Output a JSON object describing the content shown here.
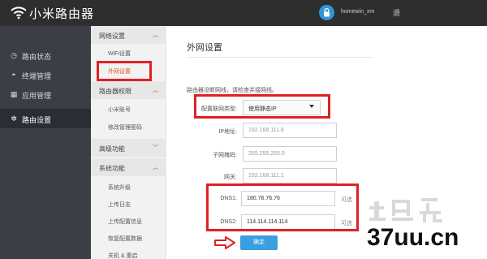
{
  "header": {
    "brand": "小米路由器",
    "user_name": "homewin_xm",
    "user_extra": "退"
  },
  "sidebar": {
    "items": [
      {
        "label": "路由状态",
        "icon": "gauge-icon"
      },
      {
        "label": "终端管理",
        "icon": "user-icon"
      },
      {
        "label": "应用管理",
        "icon": "grid-icon"
      },
      {
        "label": "路由设置",
        "icon": "gear-icon",
        "active": true
      }
    ]
  },
  "submenu": {
    "groups": [
      {
        "label": "网络设置",
        "chevron": "︿",
        "items": [
          "WiFi设置",
          "外网设置"
        ]
      },
      {
        "label": "路由器权限",
        "chevron": "︿",
        "items": [
          "小米账号",
          "修改管理密码"
        ]
      },
      {
        "label": "高级功能",
        "chevron": "﹀",
        "items": []
      },
      {
        "label": "系统功能",
        "chevron": "︿",
        "items": [
          "系统升级",
          "上传日志",
          "上传配置信息",
          "恢复配置数据",
          "关机 & 重启"
        ]
      }
    ],
    "active_item": "外网设置"
  },
  "main": {
    "title": "外网设置",
    "hint": "路由器没断网线，请检查并接网线。",
    "form": {
      "conn_type_label": "配置联网类型:",
      "conn_type_value": "使用静态IP",
      "ip_label": "IP地址:",
      "ip_value": "192.168.111.8",
      "mask_label": "子网掩码:",
      "mask_value": "255.255.255.0",
      "gateway_label": "网关:",
      "gateway_value": "192.168.111.1",
      "dns1_label": "DNS1:",
      "dns1_value": "180.76.76.76",
      "dns2_label": "DNS2:",
      "dns2_value": "114.114.114.114",
      "optional": "可选"
    },
    "submit_label": "确定"
  },
  "watermark": {
    "logo_text": "土巴兔",
    "site_text": "37uu.cn"
  },
  "colors": {
    "topbar": "#2e2e2e",
    "sidebar": "#3b3e44",
    "accent": "#3a9fe0",
    "annotation_red": "#e02024",
    "active_orange": "#e85a1c"
  }
}
